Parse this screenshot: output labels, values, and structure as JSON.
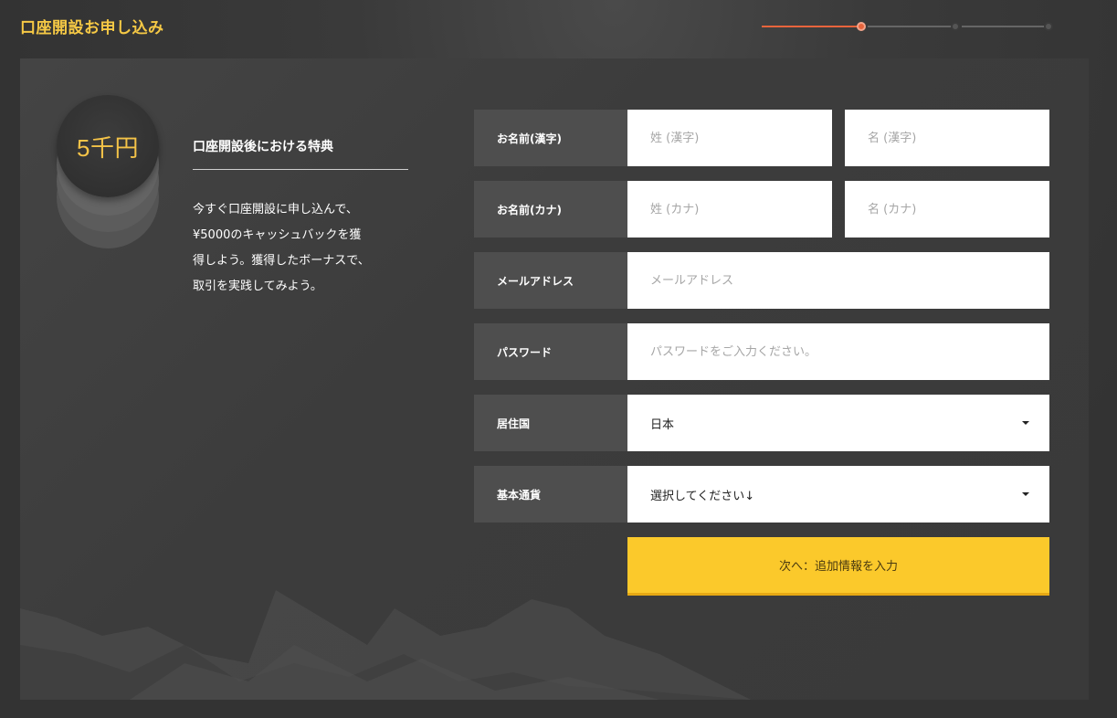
{
  "header": {
    "title": "口座開設お申し込み"
  },
  "progress": {
    "current_step": 1,
    "total_steps": 3
  },
  "bonus": {
    "coin_text": "5千円",
    "title": "口座開設後における特典",
    "lines": [
      "今すぐ口座開設に申し込んで、",
      "¥5000のキャッシュバックを獲",
      "得しよう。獲得したボーナスで、",
      "取引を実践してみよう。"
    ]
  },
  "form": {
    "name_kanji": {
      "label": "お名前(漢字)",
      "last_placeholder": "姓 (漢字)",
      "first_placeholder": "名 (漢字)"
    },
    "name_kana": {
      "label": "お名前(カナ)",
      "last_placeholder": "姓 (カナ)",
      "first_placeholder": "名 (カナ)"
    },
    "email": {
      "label": "メールアドレス",
      "placeholder": "メールアドレス"
    },
    "password": {
      "label": "パスワード",
      "placeholder": "パスワードをご入力ください。"
    },
    "country": {
      "label": "居住国",
      "value": "日本"
    },
    "currency": {
      "label": "基本通貨",
      "value": "選択してください↓"
    },
    "submit_label": "次へ：追加情報を入力"
  },
  "colors": {
    "accent": "#f6c945",
    "progress_active": "#e8643c",
    "submit_bg": "#fbc92b"
  }
}
